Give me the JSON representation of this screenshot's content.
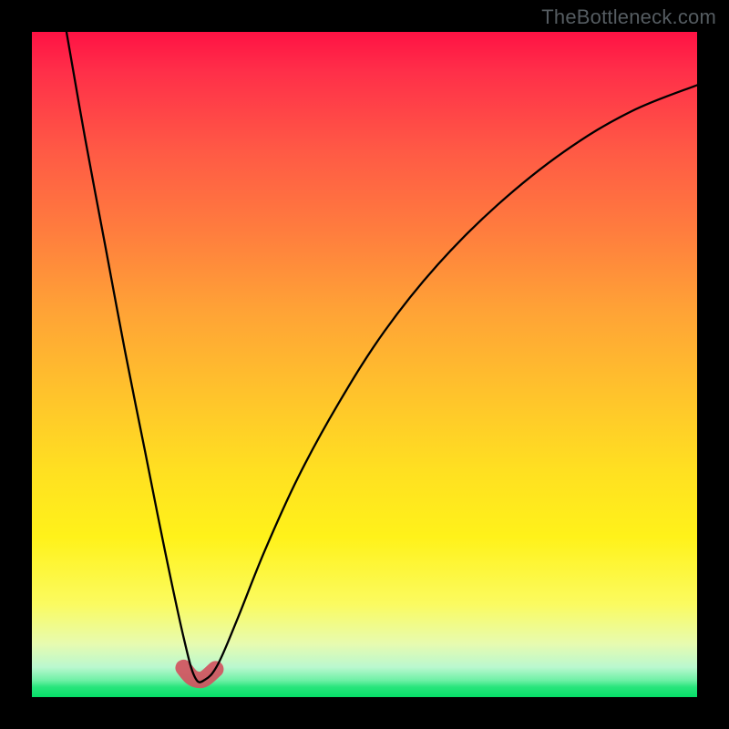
{
  "watermark": "TheBottleneck.com",
  "chart_data": {
    "type": "line",
    "title": "",
    "xlabel": "",
    "ylabel": "",
    "xlim": [
      0,
      100
    ],
    "ylim": [
      0,
      100
    ],
    "grid": false,
    "legend": false,
    "gradient_stops": [
      {
        "pos": 0,
        "color": "#ff1244"
      },
      {
        "pos": 6,
        "color": "#ff2f49"
      },
      {
        "pos": 18,
        "color": "#ff5a45"
      },
      {
        "pos": 30,
        "color": "#ff7d3e"
      },
      {
        "pos": 42,
        "color": "#ffa336"
      },
      {
        "pos": 54,
        "color": "#ffc22c"
      },
      {
        "pos": 66,
        "color": "#ffe021"
      },
      {
        "pos": 76,
        "color": "#fff21a"
      },
      {
        "pos": 86,
        "color": "#fbfb60"
      },
      {
        "pos": 92,
        "color": "#e7fbb0"
      },
      {
        "pos": 95.5,
        "color": "#baf8cf"
      },
      {
        "pos": 97.5,
        "color": "#6df0a5"
      },
      {
        "pos": 98.5,
        "color": "#28e57c"
      },
      {
        "pos": 100,
        "color": "#05df67"
      }
    ],
    "series": [
      {
        "name": "bottleneck-curve",
        "x": [
          5.2,
          8,
          11,
          14,
          17,
          20,
          22.8,
          24.5,
          26,
          28,
          31,
          35,
          40,
          46,
          53,
          61,
          70,
          80,
          90,
          100
        ],
        "y": [
          100,
          84,
          68,
          52,
          37,
          22,
          9,
          3,
          2.6,
          5,
          12,
          22,
          33,
          44,
          55,
          65,
          74,
          82,
          88,
          92
        ]
      }
    ],
    "marker": {
      "name": "optimal-range",
      "x": [
        22.8,
        24.0,
        25.0,
        26.0,
        27.6
      ],
      "y": [
        4.4,
        3.0,
        2.6,
        2.8,
        4.2
      ],
      "color": "#d1525f"
    }
  }
}
